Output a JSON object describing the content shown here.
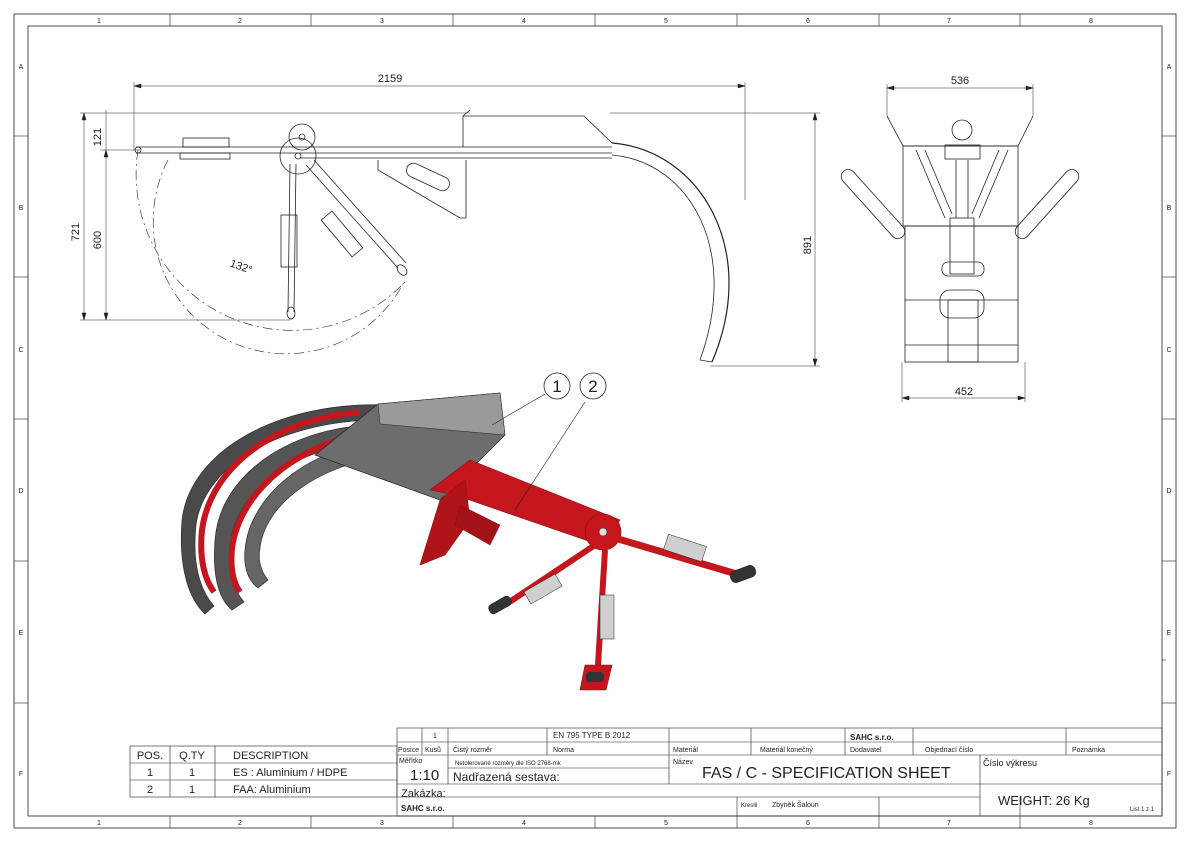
{
  "frame": {
    "columns": [
      "1",
      "2",
      "3",
      "4",
      "5",
      "6",
      "7",
      "8"
    ],
    "rows": [
      "A",
      "B",
      "C",
      "D",
      "E",
      "F"
    ]
  },
  "side_view": {
    "dim_length": "2159",
    "dim_121": "121",
    "dim_600": "600",
    "dim_721": "721",
    "dim_891": "891",
    "angle": "132°"
  },
  "front_view": {
    "dim_top": "536",
    "dim_bottom": "452"
  },
  "iso_view": {
    "balloon_1": "1",
    "balloon_2": "2"
  },
  "bom": {
    "headers": {
      "pos": "POS.",
      "qty": "Q.TY",
      "desc": "DESCRIPTION"
    },
    "rows": [
      {
        "pos": "1",
        "qty": "1",
        "desc": "ES  : Aluminium / HDPE"
      },
      {
        "pos": "2",
        "qty": "1",
        "desc": "FAA: Aluminium"
      }
    ]
  },
  "title_block": {
    "row1_num": "1",
    "norm_value": "EN 795 TYPE B 2012",
    "company_top": "SAHC s.r.o.",
    "lbl_posice": "Posice",
    "lbl_kusu": "Kusů",
    "lbl_cisty": "Čistý rozměr",
    "lbl_norma": "Norma",
    "lbl_material": "Materiál",
    "lbl_material_konecny": "Materiál konečný",
    "lbl_dodavatel": "Dodavatel",
    "lbl_objednaci": "Objednací číslo",
    "lbl_poznamka": "Poznámka",
    "lbl_meritko": "Měřítko",
    "tolerance": "Netolerované rozměry dle ISO 2768-mk",
    "lbl_nazev": "Název",
    "scale": "1:10",
    "nadrazena": "Nadřazená sestava:",
    "title": "FAS / C  - SPECIFICATION SHEET",
    "lbl_cislo": "Číslo výkresu",
    "zakazka": "Zakázka:",
    "company_bottom": "SAHC s.r.o.",
    "lbl_kreslil": "Kreslil",
    "kreslil_name": "Zbyněk Šaloun",
    "weight": "WEIGHT: 26 Kg",
    "sheet": "List 1 z 1"
  },
  "colors": {
    "line": "#222222",
    "red": "#c4161c",
    "dark_red": "#8a0e12",
    "grey": "#4a4a4a",
    "light_grey": "#8c8c8c"
  }
}
